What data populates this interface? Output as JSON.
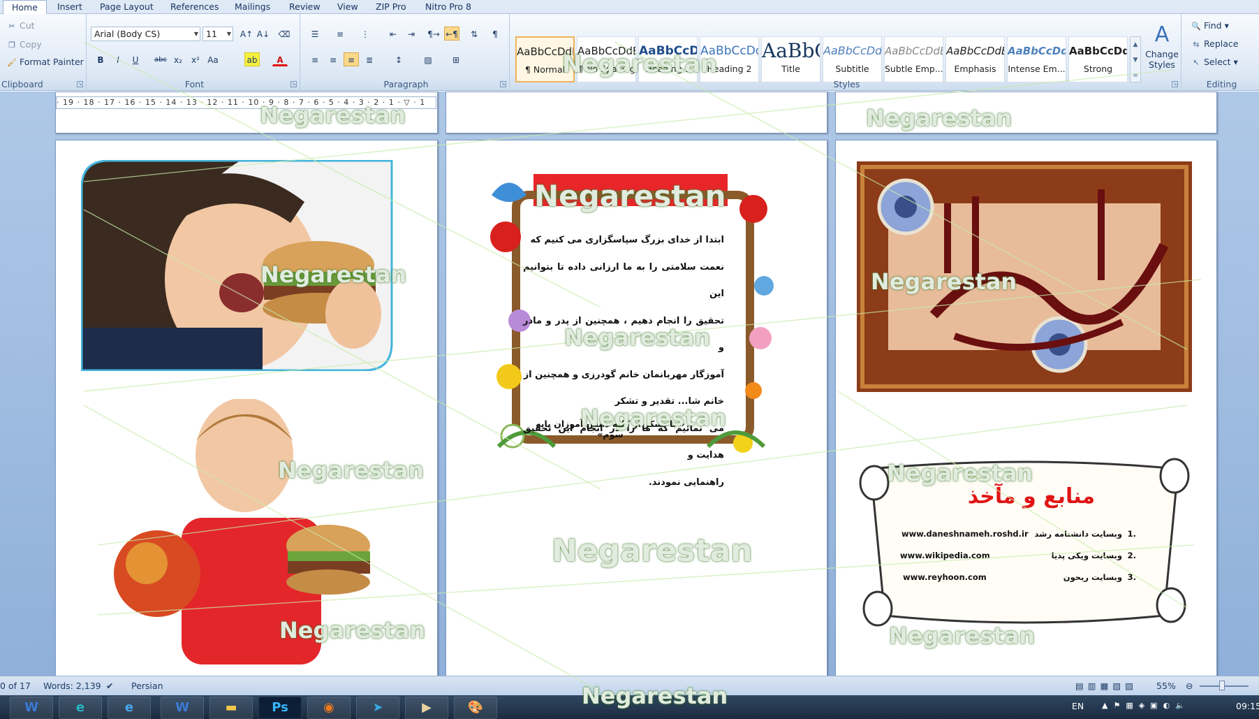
{
  "tabs": [
    "Home",
    "Insert",
    "Page Layout",
    "References",
    "Mailings",
    "Review",
    "View",
    "ZIP Pro",
    "Nitro Pro 8"
  ],
  "clipboard": {
    "cut": "Cut",
    "copy": "Copy",
    "format_painter": "Format Painter",
    "label": "Clipboard"
  },
  "font": {
    "name": "Arial (Body CS)",
    "size": "11",
    "label": "Font"
  },
  "paragraph": {
    "label": "Paragraph"
  },
  "styles": {
    "label": "Styles",
    "change_styles": "Change Styles",
    "items": [
      {
        "sample": "AaBbCcDdEe",
        "name": "¶ Normal"
      },
      {
        "sample": "AaBbCcDdEe",
        "name": "¶ No Spacing"
      },
      {
        "sample": "AaBbCcDdEe",
        "name": "Heading 1"
      },
      {
        "sample": "AaBbCcDdEe",
        "name": "Heading 2"
      },
      {
        "sample": "AaBbCcDdEe",
        "name": "Title"
      },
      {
        "sample": "AaBbCcDdEe",
        "name": "Subtitle"
      },
      {
        "sample": "AaBbCcDdEe",
        "name": "Subtle Emp..."
      },
      {
        "sample": "AaBbCcDdEe",
        "name": "Emphasis"
      },
      {
        "sample": "AaBbCcDdEe",
        "name": "Intense Em..."
      },
      {
        "sample": "AaBbCcDdEe",
        "name": "Strong"
      }
    ]
  },
  "editing": {
    "find": "Find",
    "replace": "Replace",
    "select": "Select",
    "label": "Editing"
  },
  "ruler": "· 19 · 18 · 17 · 16 · 15 · 14 · 13 · 12 · 11 · 10 · 9 · 8 · 7 · 6 · 5 · 4 · 3 · 2 · 1 · ▽ · 1",
  "thanks": {
    "lines": [
      "ابتدا از خدای بزرگ سپاسگزاری می کنیم که",
      "نعمت سلامتی را به ما ارزانی داده تا بتوانیم این",
      "تحقیق را انجام دهیم ، همچنین از پدر و مادر و",
      "آموزگار مهربانمان خانم گودرزی و همچنین از",
      "خانم شا... تقدیر و تشکر",
      "می نمائیم که ما را در انجام این تحقیق هدایت و",
      "راهنمایی نمودند."
    ],
    "signature": "« با تشکر از کلیه دانش آموزان پایه سوم»"
  },
  "sources": {
    "title": "منابع و مآخذ",
    "items": [
      {
        "num": "1.",
        "name": "وبسایت دانشنامه رشد",
        "url": "www.daneshnameh.roshd.ir"
      },
      {
        "num": "2.",
        "name": "وبسایت ویکی پدیا",
        "url": "www.wikipedia.com"
      },
      {
        "num": "3.",
        "name": "وبسایت ریحون",
        "url": "www.reyhoon.com"
      }
    ]
  },
  "status": {
    "page": "0 of 17",
    "words": "Words: 2,139",
    "language": "Persian",
    "zoom": "55%"
  },
  "taskbar": {
    "lang": "EN",
    "time": "09:15"
  },
  "watermark": "Negarestan",
  "colors": {
    "ribbon": "#dde8f5",
    "workspace": "#9ab8de",
    "source_title": "#e01515",
    "thanks_banner": "#e8262a"
  }
}
